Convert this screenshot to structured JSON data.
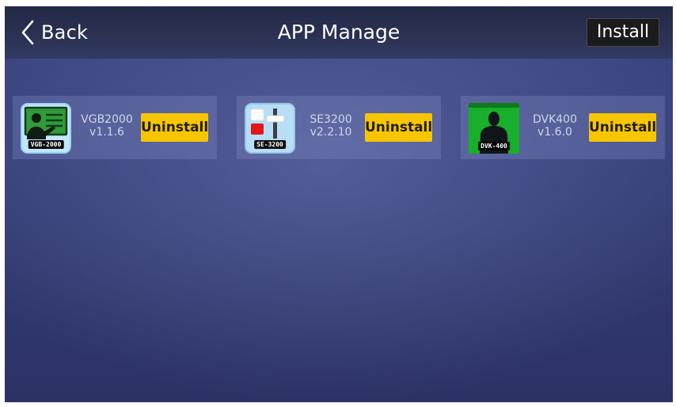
{
  "header": {
    "back_label": "Back",
    "title": "APP Manage",
    "install_label": "Install"
  },
  "apps": [
    {
      "name": "VGB2000",
      "version": "v1.1.6",
      "icon_label": "VGB-2000",
      "uninstall_label": "Uninstall"
    },
    {
      "name": "SE3200",
      "version": "v2.2.10",
      "icon_label": "SE-3200",
      "uninstall_label": "Uninstall"
    },
    {
      "name": "DVK400",
      "version": "v1.6.0",
      "icon_label": "DVK-400",
      "uninstall_label": "Uninstall"
    }
  ],
  "icons": {
    "back": "chevron-left-icon",
    "app_1": "presentation-board-icon",
    "app_2": "switcher-fader-icon",
    "app_3": "chroma-key-person-icon"
  },
  "colors": {
    "accent": "#f7c600",
    "install_button": "#1b1b1e",
    "background": "#353d76",
    "chroma_green": "#17af2b"
  }
}
